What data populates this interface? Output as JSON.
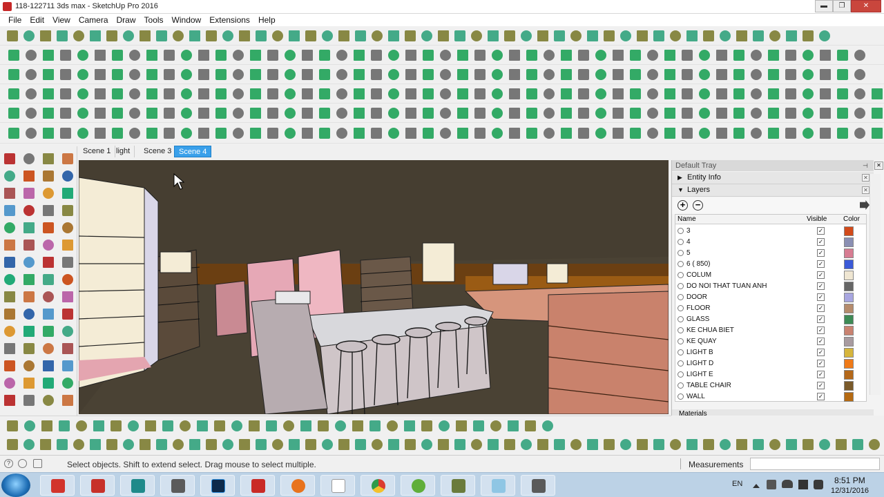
{
  "window": {
    "title": "118-122711 3ds max - SketchUp Pro 2016",
    "min_label": "▬",
    "max_label": "❐",
    "close_label": "✕"
  },
  "menu": {
    "items": [
      "File",
      "Edit",
      "View",
      "Camera",
      "Draw",
      "Tools",
      "Window",
      "Extensions",
      "Help"
    ]
  },
  "scenes": {
    "tabs": [
      "Scene 1",
      "light",
      "Scene 3",
      "Scene 4"
    ],
    "active": "Scene 4"
  },
  "tray": {
    "title": "Default Tray",
    "entity_info": "Entity Info",
    "layers": "Layers",
    "materials": "Materials",
    "columns": {
      "name": "Name",
      "visible": "Visible",
      "color": "Color"
    },
    "rows": [
      {
        "name": "3",
        "visible": true,
        "color": "#d24a1a"
      },
      {
        "name": "4",
        "visible": true,
        "color": "#8a8fb3"
      },
      {
        "name": "5",
        "visible": true,
        "color": "#d77c92"
      },
      {
        "name": "6 ( 850)",
        "visible": true,
        "color": "#3b5ad8"
      },
      {
        "name": "COLUM",
        "visible": true,
        "color": "#efe6d2"
      },
      {
        "name": "DO NOI THAT TUAN ANH",
        "visible": true,
        "color": "#666666"
      },
      {
        "name": "DOOR",
        "visible": true,
        "color": "#a8a6e0"
      },
      {
        "name": "FLOOR",
        "visible": true,
        "color": "#b58b6c"
      },
      {
        "name": "GLASS",
        "visible": true,
        "color": "#3d8a55"
      },
      {
        "name": "KE CHUA BIET",
        "visible": true,
        "color": "#c98270"
      },
      {
        "name": "KE QUAY",
        "visible": true,
        "color": "#a89ba0"
      },
      {
        "name": "LIGHT B",
        "visible": true,
        "color": "#d6b53c"
      },
      {
        "name": "LIGHT D",
        "visible": true,
        "color": "#ef7a18"
      },
      {
        "name": "LIGHT E",
        "visible": true,
        "color": "#b4681a"
      },
      {
        "name": "TABLE CHAIR",
        "visible": true,
        "color": "#7a5a2a"
      },
      {
        "name": "WALL",
        "visible": true,
        "color": "#b56a12"
      }
    ]
  },
  "status": {
    "hint": "Select objects. Shift to extend select. Drag mouse to select multiple.",
    "measurements_label": "Measurements",
    "measurements_value": ""
  },
  "taskbar": {
    "lang": "EN",
    "time": "8:51 PM",
    "date": "12/31/2016"
  },
  "check_glyph": "✓"
}
